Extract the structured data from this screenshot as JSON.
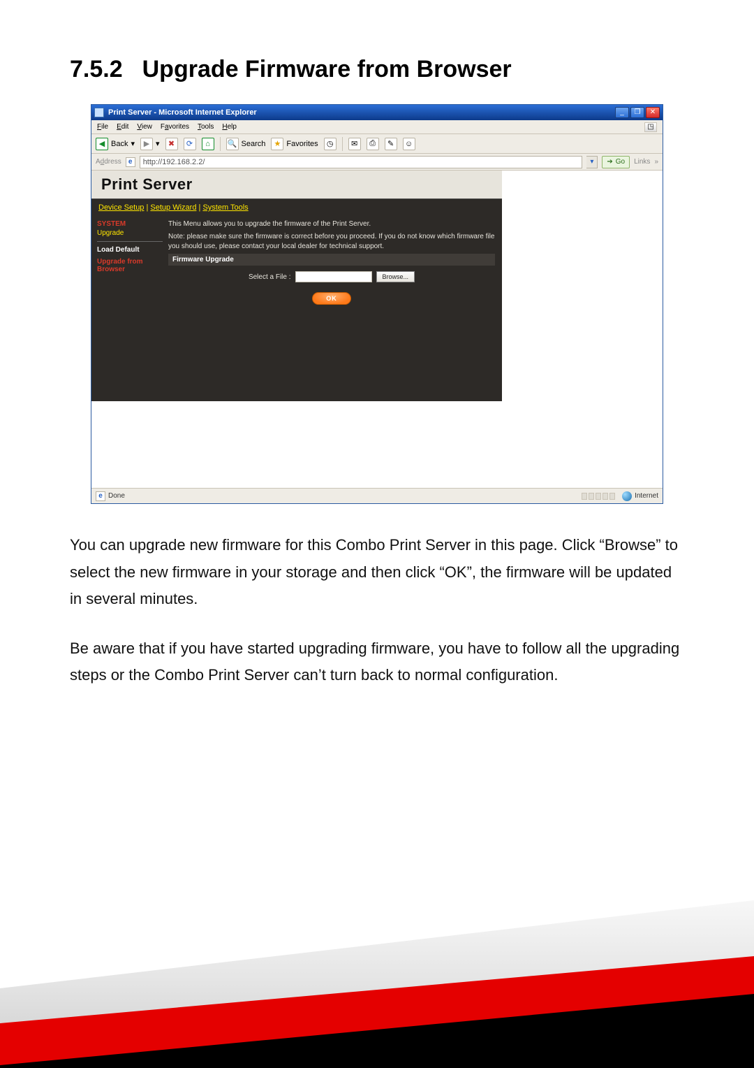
{
  "heading": {
    "number": "7.5.2",
    "title": "Upgrade Firmware from Browser"
  },
  "ie": {
    "title": "Print Server - Microsoft Internet Explorer",
    "menus": {
      "file": "File",
      "edit": "Edit",
      "view": "View",
      "favorites": "Favorites",
      "tools": "Tools",
      "help": "Help"
    },
    "toolbar": {
      "back": "Back",
      "search": "Search",
      "favorites": "Favorites"
    },
    "address": {
      "label": "Address",
      "value": "http://192.168.2.2/",
      "go": "Go",
      "links": "Links"
    },
    "status": {
      "done": "Done",
      "zone": "Internet"
    },
    "winbtns": {
      "min": "_",
      "max": "❐",
      "close": "✕"
    }
  },
  "ps": {
    "header": "Print Server",
    "nav": {
      "device": "Device Setup",
      "wizard": "Setup Wizard",
      "tools": "System Tools"
    },
    "side": {
      "system": "SYSTEM",
      "upgrade": "Upgrade",
      "load_default": "Load Default",
      "upgrade_from_browser": "Upgrade from Browser"
    },
    "intro": "This Menu allows you to upgrade the firmware of the Print Server.",
    "note": "Note: please make sure the firmware is correct before you proceed. If you do not know which firmware file you should use, please contact your local dealer for technical support.",
    "section": "Firmware Upgrade",
    "select_label": "Select a File :",
    "browse": "Browse...",
    "ok": "OK"
  },
  "body": {
    "p1": "You can upgrade new firmware for this Combo Print Server in this page. Click “Browse” to select the new firmware in your storage and then click “OK”, the firmware will be updated in several minutes.",
    "p2": "Be aware that if you have started upgrading firmware, you have to follow all the upgrading steps or the Combo Print Server can’t turn back to normal configuration."
  }
}
